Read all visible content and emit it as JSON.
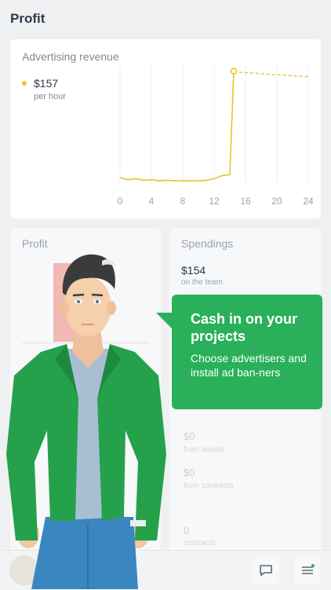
{
  "page": {
    "title": "Profit"
  },
  "revenue_card": {
    "title": "Advertising revenue",
    "value": "$157",
    "unit": "per hour",
    "accent": "#e8c32a"
  },
  "chart_data": {
    "type": "line",
    "x": [
      0,
      1,
      2,
      3,
      4,
      5,
      6,
      7,
      8,
      9,
      10,
      11,
      12,
      13,
      14,
      14.5,
      15,
      16,
      17,
      18,
      19,
      20,
      21,
      22,
      23,
      24
    ],
    "y": [
      12,
      8,
      10,
      7,
      8,
      6,
      7,
      6,
      6,
      6,
      6,
      7,
      10,
      16,
      18,
      220,
      218,
      217,
      216,
      215,
      214,
      213,
      212,
      211,
      210,
      209
    ],
    "projected_from_x": 14.5,
    "xticks": [
      "0",
      "4",
      "8",
      "12",
      "16",
      "20",
      "24"
    ],
    "xlim": [
      0,
      24
    ],
    "ylim": [
      0,
      230
    ],
    "grid": "vertical",
    "color": "#e8c32a"
  },
  "profit_card": {
    "title": "Profit"
  },
  "spendings_card": {
    "title": "Spendings",
    "value": "$154",
    "sub": "on the team",
    "faded": [
      {
        "value": "$0",
        "sub": "from quests"
      },
      {
        "value": "$0",
        "sub": "from contracts"
      },
      {
        "value": "0",
        "sub": "contracts"
      }
    ]
  },
  "tooltip": {
    "heading": "Cash in on your projects",
    "body": "Choose advertisers and install ad ban-ners",
    "color": "#2ab05a"
  },
  "bottom_bar": {
    "icons": [
      "avatar",
      "chat-icon",
      "menu-icon"
    ]
  }
}
